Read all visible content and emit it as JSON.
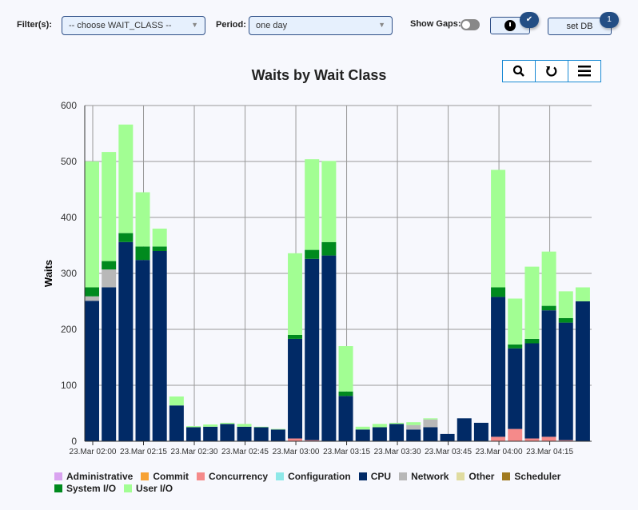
{
  "filters": {
    "filter_label": "Filter(s):",
    "filter_value": "-- choose WAIT_CLASS --",
    "period_label": "Period:",
    "period_value": "one day",
    "show_gaps_label": "Show Gaps:",
    "show_gaps": false,
    "clock_badge": "✔",
    "set_db_label": "set DB",
    "set_db_badge": "1"
  },
  "chart_data": {
    "type": "bar",
    "stacked": true,
    "title": "Waits by Wait Class",
    "xlabel": "",
    "ylabel": "Waits",
    "ylim": [
      0,
      600
    ],
    "yticks": [
      "0",
      "100",
      "200",
      "300",
      "400",
      "500",
      "600"
    ],
    "xticks": [
      "23.Mar 02:00",
      "23.Mar 02:15",
      "23.Mar 02:30",
      "23.Mar 02:45",
      "23.Mar 03:00",
      "23.Mar 03:15",
      "23.Mar 03:30",
      "23.Mar 03:45",
      "23.Mar 04:00",
      "23.Mar 04:15"
    ],
    "categories": [
      "02:00",
      "02:05",
      "02:10",
      "02:15",
      "02:20",
      "02:25",
      "02:30",
      "02:35",
      "02:40",
      "02:45",
      "02:50",
      "02:55",
      "03:00",
      "03:05",
      "03:10",
      "03:15",
      "03:20",
      "03:25",
      "03:30",
      "03:35",
      "03:40",
      "03:45",
      "03:50",
      "03:55",
      "04:00",
      "04:05",
      "04:10",
      "04:15",
      "04:20",
      "04:25"
    ],
    "grid": true,
    "legend": "bottom",
    "legend_entries": [
      {
        "name": "Administrative",
        "color": "#d9a3f0"
      },
      {
        "name": "Commit",
        "color": "#f7a234"
      },
      {
        "name": "Concurrency",
        "color": "#f58a8a"
      },
      {
        "name": "Configuration",
        "color": "#8ee8e8"
      },
      {
        "name": "CPU",
        "color": "#012a66"
      },
      {
        "name": "Network",
        "color": "#b8b8b8"
      },
      {
        "name": "Other",
        "color": "#e0dca0"
      },
      {
        "name": "Scheduler",
        "color": "#a07a20"
      },
      {
        "name": "System I/O",
        "color": "#008a1e"
      },
      {
        "name": "User I/O",
        "color": "#a2fe93"
      }
    ],
    "series": [
      {
        "name": "Concurrency",
        "color": "#f58a8a",
        "values": [
          0,
          0,
          0,
          0,
          0,
          0,
          0,
          0,
          0,
          0,
          0,
          0,
          5,
          2,
          0,
          0,
          0,
          0,
          0,
          0,
          0,
          0,
          0,
          0,
          8,
          22,
          5,
          8,
          2,
          0
        ]
      },
      {
        "name": "CPU",
        "color": "#012a66",
        "values": [
          251,
          275,
          356,
          324,
          340,
          64,
          25,
          26,
          31,
          26,
          25,
          21,
          178,
          324,
          332,
          81,
          21,
          25,
          31,
          21,
          25,
          13,
          41,
          33,
          250,
          144,
          170,
          226,
          210,
          250
        ]
      },
      {
        "name": "Network",
        "color": "#b8b8b8",
        "values": [
          8,
          32,
          0,
          0,
          0,
          0,
          0,
          0,
          0,
          0,
          0,
          0,
          0,
          0,
          0,
          0,
          0,
          0,
          0,
          8,
          14,
          0,
          0,
          0,
          0,
          0,
          0,
          0,
          0,
          0
        ]
      },
      {
        "name": "System I/O",
        "color": "#008a1e",
        "values": [
          16,
          15,
          16,
          24,
          8,
          0,
          0,
          0,
          0,
          0,
          0,
          0,
          7,
          16,
          24,
          8,
          0,
          0,
          0,
          0,
          0,
          0,
          0,
          0,
          17,
          7,
          8,
          8,
          8,
          0
        ]
      },
      {
        "name": "User I/O",
        "color": "#a2fe93",
        "values": [
          225,
          195,
          194,
          97,
          32,
          16,
          2,
          4,
          2,
          5,
          1,
          1,
          146,
          162,
          145,
          81,
          5,
          6,
          2,
          5,
          2,
          0,
          0,
          0,
          210,
          82,
          129,
          97,
          48,
          25
        ]
      }
    ]
  }
}
